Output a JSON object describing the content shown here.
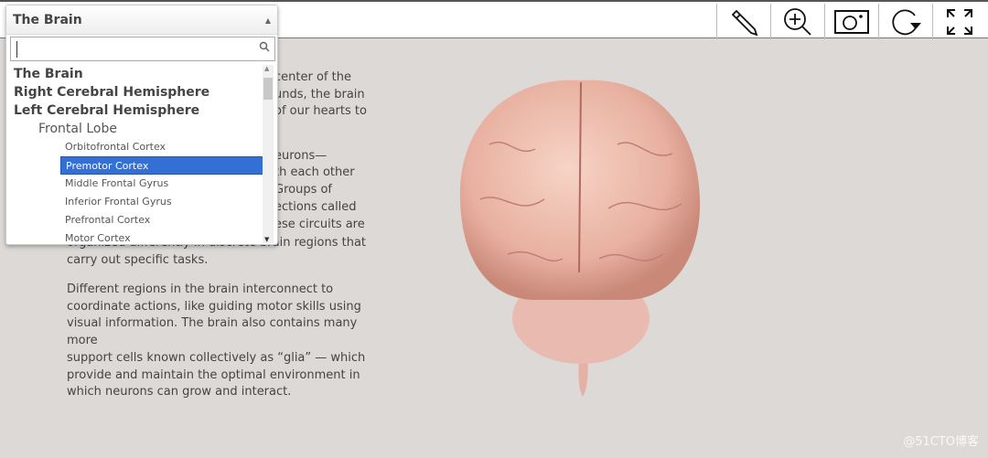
{
  "toolbar": {
    "tools": [
      {
        "icon": "pencil-icon"
      },
      {
        "icon": "zoom-in-icon"
      },
      {
        "icon": "camera-icon"
      },
      {
        "icon": "rotate-icon"
      },
      {
        "icon": "fullscreen-icon"
      }
    ]
  },
  "dropdown": {
    "selected": "The Brain",
    "search_value": "",
    "items": [
      {
        "label": "The Brain",
        "level": 0
      },
      {
        "label": "Right Cerebral Hemisphere",
        "level": 0
      },
      {
        "label": "Left Cerebral Hemisphere",
        "level": 0
      },
      {
        "label": "Frontal Lobe",
        "level": 1
      },
      {
        "label": "Orbitofrontal Cortex",
        "level": 2
      },
      {
        "label": "Premotor Cortex",
        "level": 2,
        "selected": true
      },
      {
        "label": "Middle Frontal Gyrus",
        "level": 2
      },
      {
        "label": "Inferior Frontal Gyrus",
        "level": 2
      },
      {
        "label": "Prefrontal Cortex",
        "level": 2
      },
      {
        "label": "Motor Cortex",
        "level": 2
      }
    ]
  },
  "content": {
    "visible_fragments": [
      "center of the",
      "unds, the brain",
      "of our hearts to",
      "",
      "",
      "eurons—",
      "th each other",
      "Groups of",
      "ections called",
      "ese circuits are"
    ],
    "para1_tail": [
      "organized differently in discrete brain regions that",
      "carry out specific tasks."
    ],
    "para2": [
      "Different regions in the brain interconnect to",
      "coordinate actions, like guiding motor skills using",
      "visual information. The brain also contains many more",
      "support cells known collectively as “glia” — which",
      "provide and maintain the optimal environment in",
      "which neurons can grow and interact."
    ]
  },
  "watermark": "@51CTO博客",
  "colors": {
    "selection": "#3470d4",
    "background": "#dcd9d6"
  }
}
